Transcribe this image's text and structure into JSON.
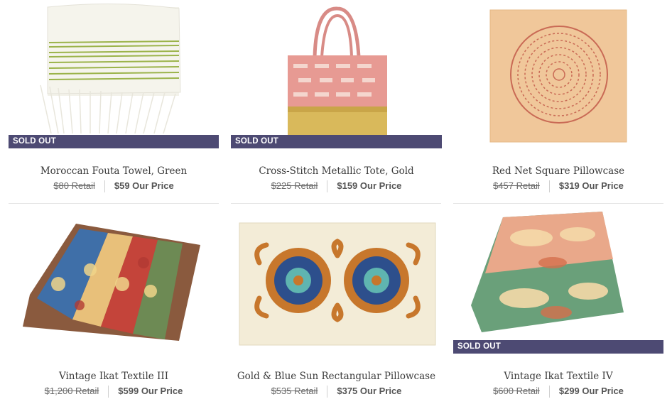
{
  "sold_out_label": "SOLD OUT",
  "products": [
    {
      "title": "Moroccan Fouta Towel, Green",
      "retail": "$80 Retail",
      "price": "$59 Our Price",
      "sold_out": true
    },
    {
      "title": "Cross-Stitch Metallic Tote, Gold",
      "retail": "$225 Retail",
      "price": "$159 Our Price",
      "sold_out": true
    },
    {
      "title": "Red Net Square Pillowcase",
      "retail": "$457 Retail",
      "price": "$319 Our Price",
      "sold_out": false
    },
    {
      "title": "Vintage Ikat Textile III",
      "retail": "$1,200 Retail",
      "price": "$599 Our Price",
      "sold_out": false
    },
    {
      "title": "Gold & Blue Sun Rectangular Pillowcase",
      "retail": "$535 Retail",
      "price": "$375 Our Price",
      "sold_out": false
    },
    {
      "title": "Vintage Ikat Textile IV",
      "retail": "$600 Retail",
      "price": "$299 Our Price",
      "sold_out": true
    }
  ],
  "colors": {
    "badge": "#4d4a73",
    "title": "#3a3a3a",
    "price": "#555555"
  }
}
